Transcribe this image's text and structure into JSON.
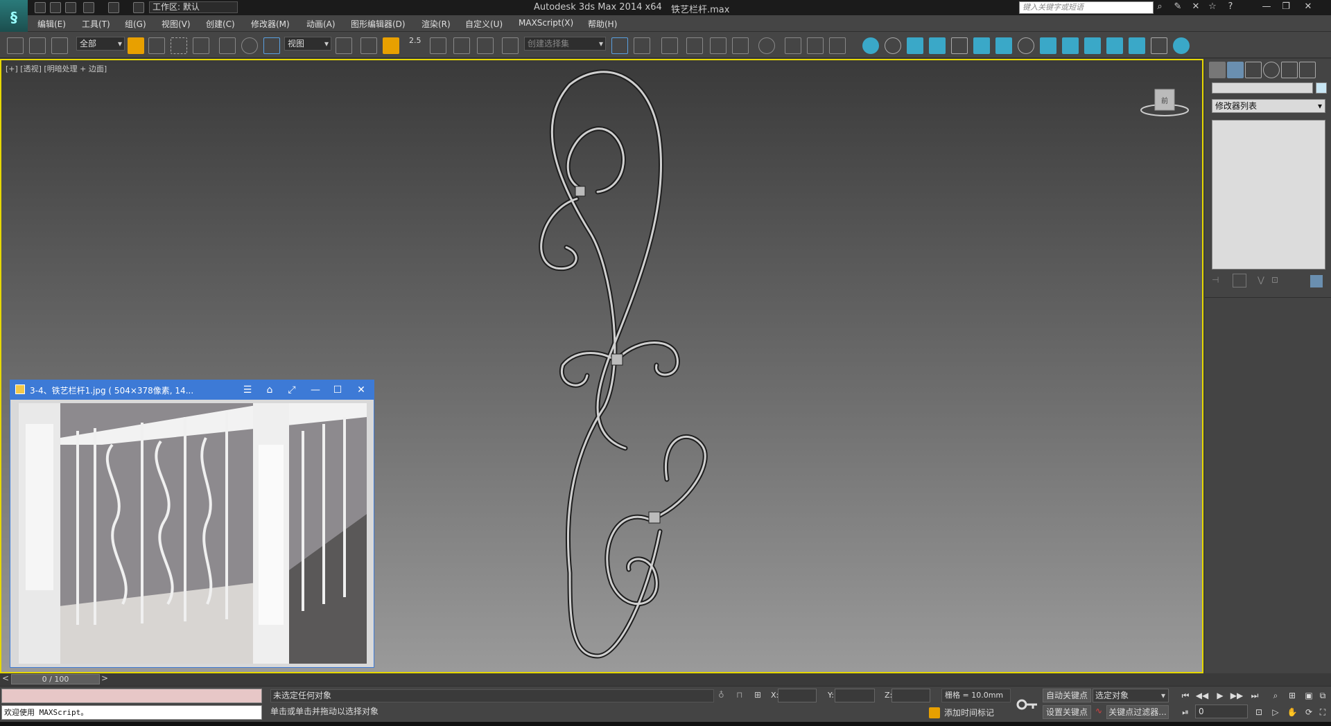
{
  "titlebar": {
    "workspace": "工作区: 默认",
    "app_title": "Autodesk 3ds Max  2014 x64",
    "file_name": "铁艺栏杆.max",
    "search_placeholder": "键入关键字或短语"
  },
  "menus": [
    "编辑(E)",
    "工具(T)",
    "组(G)",
    "视图(V)",
    "创建(C)",
    "修改器(M)",
    "动画(A)",
    "图形编辑器(D)",
    "渲染(R)",
    "自定义(U)",
    "MAXScript(X)",
    "帮助(H)"
  ],
  "toolbar": {
    "selection_filter": "全部",
    "ref_coord": "视图",
    "snap_value": "2.5",
    "named_selection": "创建选择集"
  },
  "viewport": {
    "label": "[+] [透视] [明暗处理 + 边面]",
    "viewcube_label": "前"
  },
  "image_viewer": {
    "title": "3-4、铁艺栏杆1.jpg ( 504×378像素, 14..."
  },
  "command_panel": {
    "modifier_list": "修改器列表"
  },
  "timeline": {
    "position": "0 / 100"
  },
  "status": {
    "selection": "未选定任何对象",
    "prompt": "单击或单击并拖动以选择对象",
    "maxscript_welcome": "欢迎使用 MAXScript。",
    "x_label": "X:",
    "y_label": "Y:",
    "z_label": "Z:",
    "grid": "栅格 = 10.0mm",
    "add_time_tag": "添加时间标记",
    "auto_key": "自动关键点",
    "set_key": "设置关键点",
    "key_mode": "选定对象",
    "key_filters": "关键点过滤器...",
    "current_frame": "0"
  }
}
